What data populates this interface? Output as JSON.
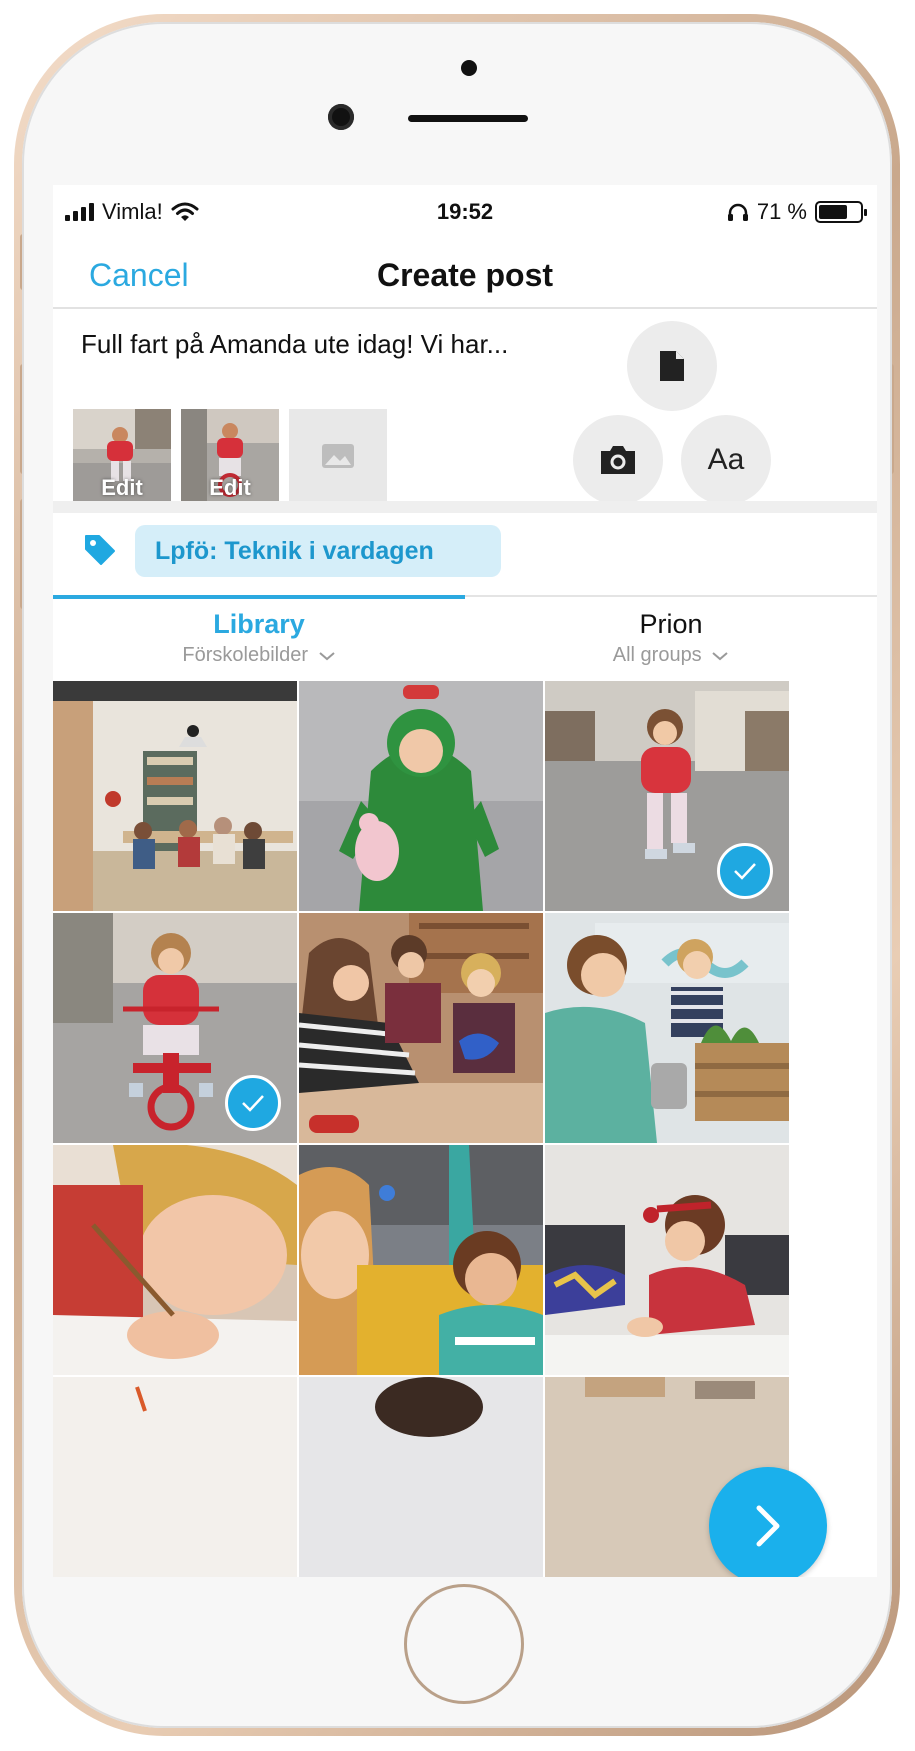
{
  "status_bar": {
    "carrier": "Vimla!",
    "time": "19:52",
    "battery_percent": "71 %",
    "battery_level": 0.71
  },
  "nav": {
    "cancel_label": "Cancel",
    "title": "Create post"
  },
  "composer": {
    "post_text": "Full fart på Amanda ute idag! Vi har...",
    "thumb_edit_label": "Edit",
    "text_button_label": "Aa"
  },
  "tag": {
    "label": "Lpfö: Teknik i vardagen"
  },
  "tabs": [
    {
      "label": "Library",
      "sub": "Förskolebilder",
      "active": true
    },
    {
      "label": "Prion",
      "sub": "All groups",
      "active": false
    }
  ],
  "colors": {
    "accent": "#2ba9e0",
    "chip_bg": "#d5eef9",
    "fab": "#1ab0ec"
  },
  "icons": [
    "signal-icon",
    "wifi-icon",
    "headphones-icon",
    "battery-icon",
    "document-icon",
    "camera-icon",
    "image-placeholder-icon",
    "tag-icon",
    "chevron-down-icon",
    "checkmark-icon",
    "chevron-right-icon"
  ]
}
